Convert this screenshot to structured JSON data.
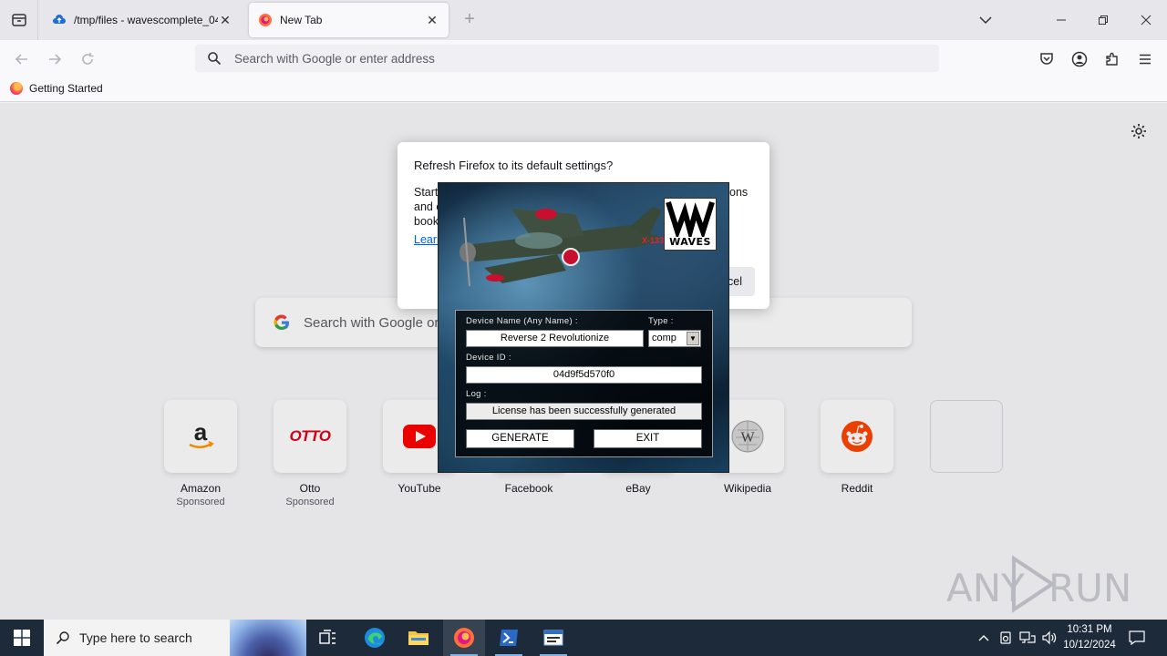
{
  "browser": {
    "tabs": [
      {
        "title": "/tmp/files - wavescomplete_04",
        "active": false
      },
      {
        "title": "New Tab",
        "active": true
      }
    ],
    "urlbar": {
      "placeholder": "Search with Google or enter address"
    },
    "bookmarks": [
      {
        "label": "Getting Started"
      }
    ]
  },
  "newtab": {
    "search_placeholder": "Search with Google or enter address",
    "shortcuts": [
      {
        "label": "Amazon",
        "sponsored": "Sponsored",
        "icon": "amazon-icon"
      },
      {
        "label": "Otto",
        "sponsored": "Sponsored",
        "icon": "otto-icon"
      },
      {
        "label": "YouTube",
        "sponsored": "",
        "icon": "youtube-icon"
      },
      {
        "label": "Facebook",
        "sponsored": "",
        "icon": "facebook-icon"
      },
      {
        "label": "eBay",
        "sponsored": "",
        "icon": "ebay-icon"
      },
      {
        "label": "Wikipedia",
        "sponsored": "",
        "icon": "wikipedia-icon"
      },
      {
        "label": "Reddit",
        "sponsored": "",
        "icon": "reddit-icon"
      },
      {
        "label": "",
        "sponsored": "",
        "icon": ""
      }
    ],
    "otto_logo_text": "OTTO"
  },
  "refresh_dialog": {
    "title": "Refresh Firefox to its default settings?",
    "body_left": "Start\nand c\nbook",
    "body_right": "ons",
    "learn_more": "Learn",
    "cancel_label": "cel"
  },
  "keygen": {
    "logo_text": "WAVES",
    "plane_marking": "X-133",
    "device_name_label": "Device Name (Any Name) :",
    "device_name_value": "Reverse 2 Revolutionize",
    "type_label": "Type :",
    "type_value": "comp",
    "device_id_label": "Device ID :",
    "device_id_value": "04d9f5d570f0",
    "log_label": "Log :",
    "log_value": "License has been successfully generated",
    "generate_label": "GENERATE",
    "exit_label": "EXIT"
  },
  "watermark": {
    "text_left": "ANY",
    "text_right": "RUN"
  },
  "taskbar": {
    "search_placeholder": "Type here to search",
    "time": "10:31 PM",
    "date": "10/12/2024"
  },
  "colors": {
    "accent": "#0061e0",
    "taskbar": "#1c2a3a",
    "firefox_orange": "#ff7139"
  }
}
